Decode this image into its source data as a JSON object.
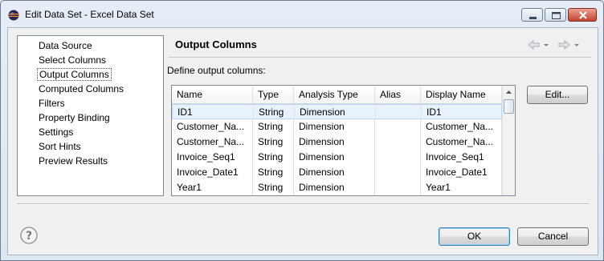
{
  "window": {
    "title": "Edit Data Set - Excel Data Set"
  },
  "nav": {
    "items": [
      {
        "label": "Data Source"
      },
      {
        "label": "Select Columns"
      },
      {
        "label": "Output Columns"
      },
      {
        "label": "Computed Columns"
      },
      {
        "label": "Filters"
      },
      {
        "label": "Property Binding"
      },
      {
        "label": "Settings"
      },
      {
        "label": "Sort Hints"
      },
      {
        "label": "Preview Results"
      }
    ],
    "selected_index": 2
  },
  "panel": {
    "title": "Output Columns",
    "define_label": "Define output columns:"
  },
  "table": {
    "headers": [
      "Name",
      "Type",
      "Analysis Type",
      "Alias",
      "Display Name"
    ],
    "rows": [
      [
        "ID1",
        "String",
        "Dimension",
        "",
        "ID1"
      ],
      [
        "Customer_Na...",
        "String",
        "Dimension",
        "",
        "Customer_Na..."
      ],
      [
        "Customer_Na...",
        "String",
        "Dimension",
        "",
        "Customer_Na..."
      ],
      [
        "Invoice_Seq1",
        "String",
        "Dimension",
        "",
        "Invoice_Seq1"
      ],
      [
        "Invoice_Date1",
        "String",
        "Dimension",
        "",
        "Invoice_Date1"
      ],
      [
        "Year1",
        "String",
        "Dimension",
        "",
        "Year1"
      ]
    ],
    "selected_row": 0
  },
  "buttons": {
    "edit": "Edit...",
    "ok": "OK",
    "cancel": "Cancel"
  },
  "icons": {
    "app": "eclipse-icon",
    "help": "help-icon",
    "back": "arrow-left-icon",
    "forward": "arrow-right-icon"
  },
  "colors": {
    "selection": "#e8f2fd",
    "ok_border": "#3c7fb1"
  }
}
